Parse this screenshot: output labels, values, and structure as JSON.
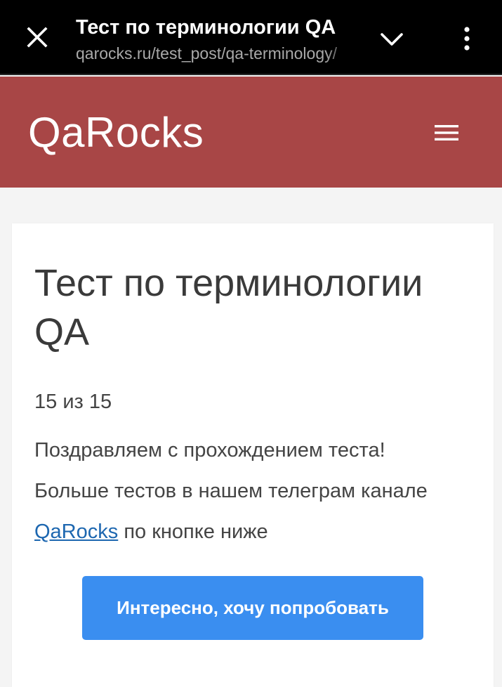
{
  "browser": {
    "tab_title": "Тест по терминологии QA",
    "url": "qarocks.ru/test_post/qa-terminology/",
    "icons": [
      "close-icon",
      "chevron-down-icon",
      "more-vert-icon"
    ],
    "bar_color": "#000000"
  },
  "header": {
    "logo": "QaRocks",
    "background_color": "#a84646",
    "menu_icon": "hamburger-icon"
  },
  "post": {
    "title": "Тест по терминологии QA",
    "score": "15 из 15",
    "message_line1": "Поздравляем с прохождением теста!",
    "message_line2_prefix": "Больше тестов в нашем телеграм канале ",
    "message_link": "QaRocks",
    "message_line2_suffix": " по кнопке ниже",
    "link_color": "#1d67b0"
  },
  "cta": {
    "label": "Интересно, хочу попробовать",
    "color": "#3a8ef0"
  }
}
